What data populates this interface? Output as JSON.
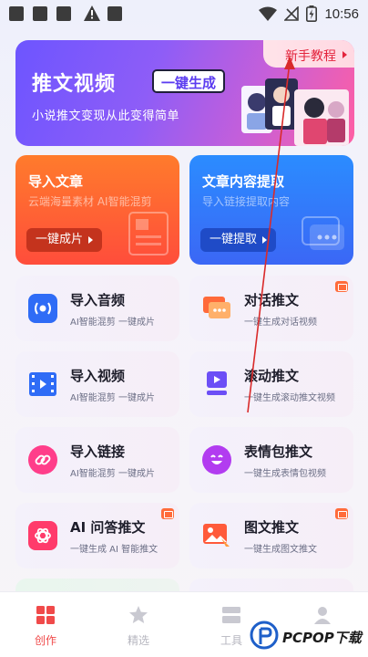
{
  "status_bar": {
    "time": "10:56"
  },
  "banner": {
    "title": "推文视频",
    "badge": "一键生成",
    "subtitle": "小说推文变现从此变得简单",
    "tutorial": "新手教程"
  },
  "features": [
    {
      "title": "导入文章",
      "subtitle": "云端海量素材 AI智能混剪",
      "button": "一键成片"
    },
    {
      "title": "文章内容提取",
      "subtitle": "导入链接提取内容",
      "button": "一键提取"
    }
  ],
  "tools": [
    {
      "title": "导入音频",
      "subtitle": "AI智能混剪  一键成片",
      "icon": "audio-icon"
    },
    {
      "title": "对话推文",
      "subtitle": "一键生成对话视频",
      "icon": "chat-icon"
    },
    {
      "title": "导入视频",
      "subtitle": "AI智能混剪  一键成片",
      "icon": "film-icon"
    },
    {
      "title": "滚动推文",
      "subtitle": "一键生成滚动推文视频",
      "icon": "play-scroll-icon"
    },
    {
      "title": "导入链接",
      "subtitle": "AI智能混剪  一键成片",
      "icon": "link-icon"
    },
    {
      "title": "表情包推文",
      "subtitle": "一键生成表情包视频",
      "icon": "emoji-icon"
    },
    {
      "title": "AI 问答推文",
      "subtitle": "一键生成 AI 智能推文",
      "icon": "ai-icon"
    },
    {
      "title": "图文推文",
      "subtitle": "一键生成图文推文",
      "icon": "image-icon"
    }
  ],
  "nav": [
    {
      "label": "创作",
      "icon": "create-icon",
      "active": true
    },
    {
      "label": "精选",
      "icon": "star-icon",
      "active": false
    },
    {
      "label": "工具",
      "icon": "tools-icon",
      "active": false
    },
    {
      "label": "我的",
      "icon": "profile-icon",
      "active": false
    }
  ],
  "watermark": {
    "text": "PCPOP下载"
  },
  "colors": {
    "accent": "#f04a4a",
    "orange": "#ff5a36",
    "blue": "#2f7bff",
    "purple": "#7c57ff"
  }
}
